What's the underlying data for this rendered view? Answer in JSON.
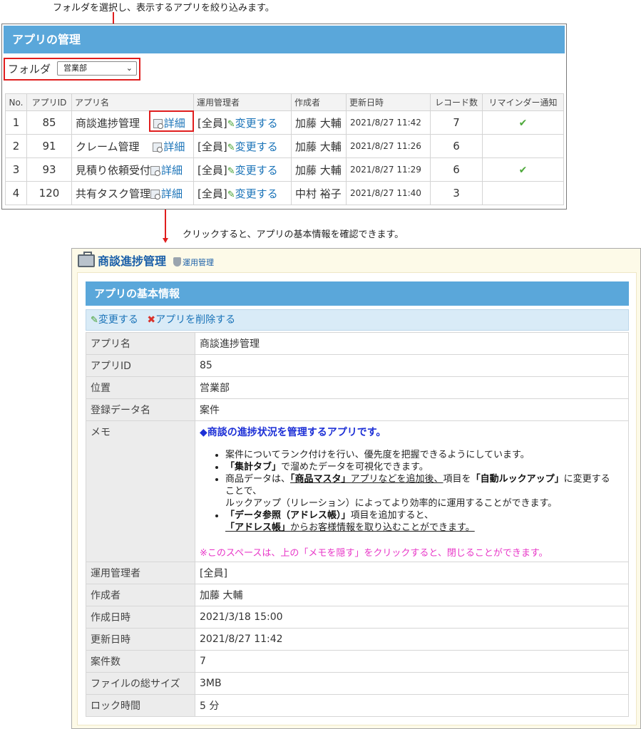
{
  "annotations": {
    "top_note": "フォルダを選択し、表示するアプリを絞り込みます。",
    "middle_note": "クリックすると、アプリの基本情報を確認できます。"
  },
  "list_panel": {
    "title": "アプリの管理",
    "folder_label": "フォルダ",
    "folder_selected": "営業部",
    "columns": [
      "No.",
      "アプリID",
      "アプリ名",
      "運用管理者",
      "作成者",
      "更新日時",
      "レコード数",
      "リマインダー通知"
    ],
    "detail_link": "詳細",
    "change_link": "変更する",
    "rows": [
      {
        "no": "1",
        "id": "85",
        "name": "商談進捗管理",
        "admin": "[全員]",
        "creator": "加藤 大輔",
        "updated": "2021/8/27 11:42",
        "records": "7",
        "reminder": true
      },
      {
        "no": "2",
        "id": "91",
        "name": "クレーム管理",
        "admin": "[全員]",
        "creator": "加藤 大輔",
        "updated": "2021/8/27 11:26",
        "records": "6",
        "reminder": false
      },
      {
        "no": "3",
        "id": "93",
        "name": "見積り依頼受付",
        "admin": "[全員]",
        "creator": "加藤 大輔",
        "updated": "2021/8/27 11:29",
        "records": "6",
        "reminder": true
      },
      {
        "no": "4",
        "id": "120",
        "name": "共有タスク管理",
        "admin": "[全員]",
        "creator": "中村 裕子",
        "updated": "2021/8/27 11:40",
        "records": "3",
        "reminder": false
      }
    ]
  },
  "detail_panel": {
    "app_name": "商談進捗管理",
    "admin_link": "運用管理",
    "section_title": "アプリの基本情報",
    "change_action": "変更する",
    "delete_action": "アプリを削除する",
    "fields": {
      "app_name": {
        "label": "アプリ名",
        "value": "商談進捗管理"
      },
      "app_id": {
        "label": "アプリID",
        "value": "85"
      },
      "location": {
        "label": "位置",
        "value": "営業部"
      },
      "data_name": {
        "label": "登録データ名",
        "value": "案件"
      },
      "memo": {
        "label": "メモ"
      },
      "admin": {
        "label": "運用管理者",
        "value": "[全員]"
      },
      "creator": {
        "label": "作成者",
        "value": "加藤 大輔"
      },
      "created": {
        "label": "作成日時",
        "value": "2021/3/18 15:00"
      },
      "updated": {
        "label": "更新日時",
        "value": "2021/8/27 11:42"
      },
      "count": {
        "label": "案件数",
        "value": "7"
      },
      "file_size": {
        "label": "ファイルの総サイズ",
        "value": "3MB"
      },
      "lock_time": {
        "label": "ロック時間",
        "value": "5 分"
      }
    },
    "memo": {
      "headline": "◆商談の進捗状況を管理するアプリです。",
      "b1": "案件についてランク付けを行い、優先度を把握できるようにしています。",
      "b2_bold": "「集計タブ」",
      "b2_rest": "で溜めたデータを可視化できます。",
      "b3_pre": "商品データは、",
      "b3_u1": "「商品マスタ」",
      "b3_u2": "アプリなどを追加後、",
      "b3_mid": "項目を",
      "b3_bold": "「自動ルックアップ」",
      "b3_line2": "に変更することで、",
      "b3_line3": "ルックアップ（リレーション）によってより効率的に運用することができます。",
      "b4_bold": "「データ参照（アドレス帳）」",
      "b4_rest": "項目を追加すると、",
      "b4_line2_bold": "「アドレス帳」",
      "b4_line2_rest": "からお客様情報を取り込むことができます。",
      "note": "※このスペースは、上の「メモを隠す」をクリックすると、閉じることができます。"
    }
  },
  "colors": {
    "header_blue": "#5aa7da",
    "link_blue": "#1a73b8",
    "annotation_red": "#e01e1e",
    "memo_blue": "#1c2fd6",
    "memo_pink": "#e838c8"
  }
}
